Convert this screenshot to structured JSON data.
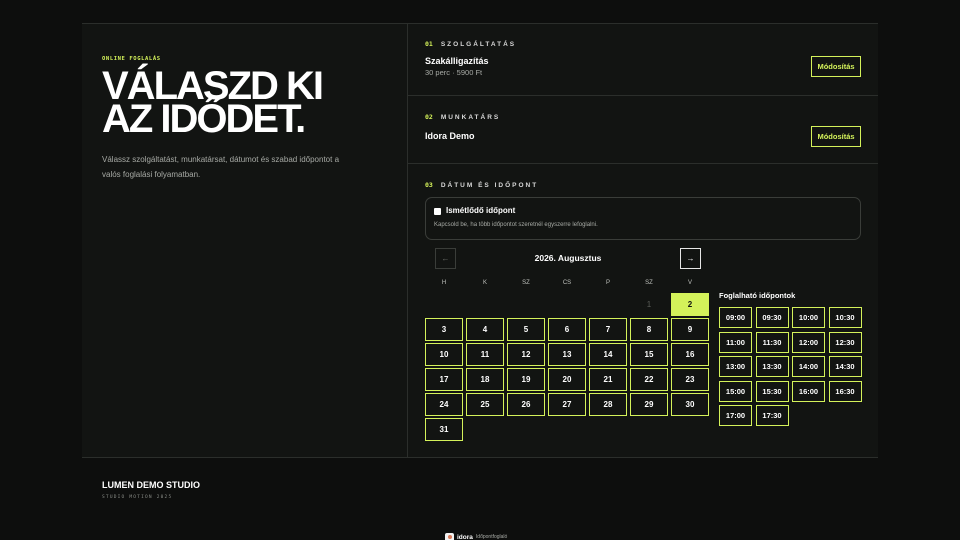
{
  "hero": {
    "eyebrow": "ONLINE FOGLALÁS",
    "title_line1": "VÁLASZD KI",
    "title_line2": "AZ IDŐDET.",
    "intro": "Válassz szolgáltatást, munkatársat, dátumot és szabad időpontot a valós foglalási folyamatban."
  },
  "service": {
    "num": "01",
    "heading": "SZOLGÁLTATÁS",
    "title": "Szakálligazítás",
    "details": "30 perc · 5900 Ft",
    "button": "Módosítás"
  },
  "staff": {
    "num": "02",
    "heading": "MUNKATÁRS",
    "title": "Idora Demo",
    "button": "Módosítás"
  },
  "datetime": {
    "num": "03",
    "heading": "DÁTUM ÉS IDŐPONT",
    "recurring_title": "Ismétlődő időpont",
    "recurring_help": "Kapcsold be, ha több időpontot szeretnél egyszerre lefoglalni.",
    "recurring_checked": false,
    "prev": "←",
    "next": "→",
    "month": "2026. Augusztus"
  },
  "calendar": {
    "weekdays": [
      "H",
      "K",
      "SZ",
      "CS",
      "P",
      "SZ",
      "V"
    ],
    "days": [
      {
        "label": "1",
        "col": 5,
        "row": 0,
        "state": "disabled"
      },
      {
        "label": "2",
        "col": 6,
        "row": 0,
        "state": "selected"
      },
      {
        "label": "3",
        "col": 0,
        "row": 1,
        "state": "available"
      },
      {
        "label": "4",
        "col": 1,
        "row": 1,
        "state": "available"
      },
      {
        "label": "5",
        "col": 2,
        "row": 1,
        "state": "available"
      },
      {
        "label": "6",
        "col": 3,
        "row": 1,
        "state": "available"
      },
      {
        "label": "7",
        "col": 4,
        "row": 1,
        "state": "available"
      },
      {
        "label": "8",
        "col": 5,
        "row": 1,
        "state": "available"
      },
      {
        "label": "9",
        "col": 6,
        "row": 1,
        "state": "available"
      },
      {
        "label": "10",
        "col": 0,
        "row": 2,
        "state": "available"
      },
      {
        "label": "11",
        "col": 1,
        "row": 2,
        "state": "available"
      },
      {
        "label": "12",
        "col": 2,
        "row": 2,
        "state": "available"
      },
      {
        "label": "13",
        "col": 3,
        "row": 2,
        "state": "available"
      },
      {
        "label": "14",
        "col": 4,
        "row": 2,
        "state": "available"
      },
      {
        "label": "15",
        "col": 5,
        "row": 2,
        "state": "available"
      },
      {
        "label": "16",
        "col": 6,
        "row": 2,
        "state": "available"
      },
      {
        "label": "17",
        "col": 0,
        "row": 3,
        "state": "available"
      },
      {
        "label": "18",
        "col": 1,
        "row": 3,
        "state": "available"
      },
      {
        "label": "19",
        "col": 2,
        "row": 3,
        "state": "available"
      },
      {
        "label": "20",
        "col": 3,
        "row": 3,
        "state": "available"
      },
      {
        "label": "21",
        "col": 4,
        "row": 3,
        "state": "available"
      },
      {
        "label": "22",
        "col": 5,
        "row": 3,
        "state": "available"
      },
      {
        "label": "23",
        "col": 6,
        "row": 3,
        "state": "available"
      },
      {
        "label": "24",
        "col": 0,
        "row": 4,
        "state": "available"
      },
      {
        "label": "25",
        "col": 1,
        "row": 4,
        "state": "available"
      },
      {
        "label": "26",
        "col": 2,
        "row": 4,
        "state": "available"
      },
      {
        "label": "27",
        "col": 3,
        "row": 4,
        "state": "available"
      },
      {
        "label": "28",
        "col": 4,
        "row": 4,
        "state": "available"
      },
      {
        "label": "29",
        "col": 5,
        "row": 4,
        "state": "available"
      },
      {
        "label": "30",
        "col": 6,
        "row": 4,
        "state": "available"
      },
      {
        "label": "31",
        "col": 0,
        "row": 5,
        "state": "available"
      }
    ]
  },
  "slots": {
    "title": "Foglalható időpontok",
    "times": [
      "09:00",
      "09:30",
      "10:00",
      "10:30",
      "11:00",
      "11:30",
      "12:00",
      "12:30",
      "13:00",
      "13:30",
      "14:00",
      "14:30",
      "15:00",
      "15:30",
      "16:00",
      "16:30",
      "17:00",
      "17:30"
    ]
  },
  "footer": {
    "studio": "LUMEN DEMO STUDIO",
    "studio_sub": "STUDIO MOTION 2025",
    "brand": "idora",
    "brand_sub": "Időpontfoglaló"
  },
  "colors": {
    "accent": "#d4f25a",
    "background": "#0d0e0d",
    "panel": "#121412"
  }
}
